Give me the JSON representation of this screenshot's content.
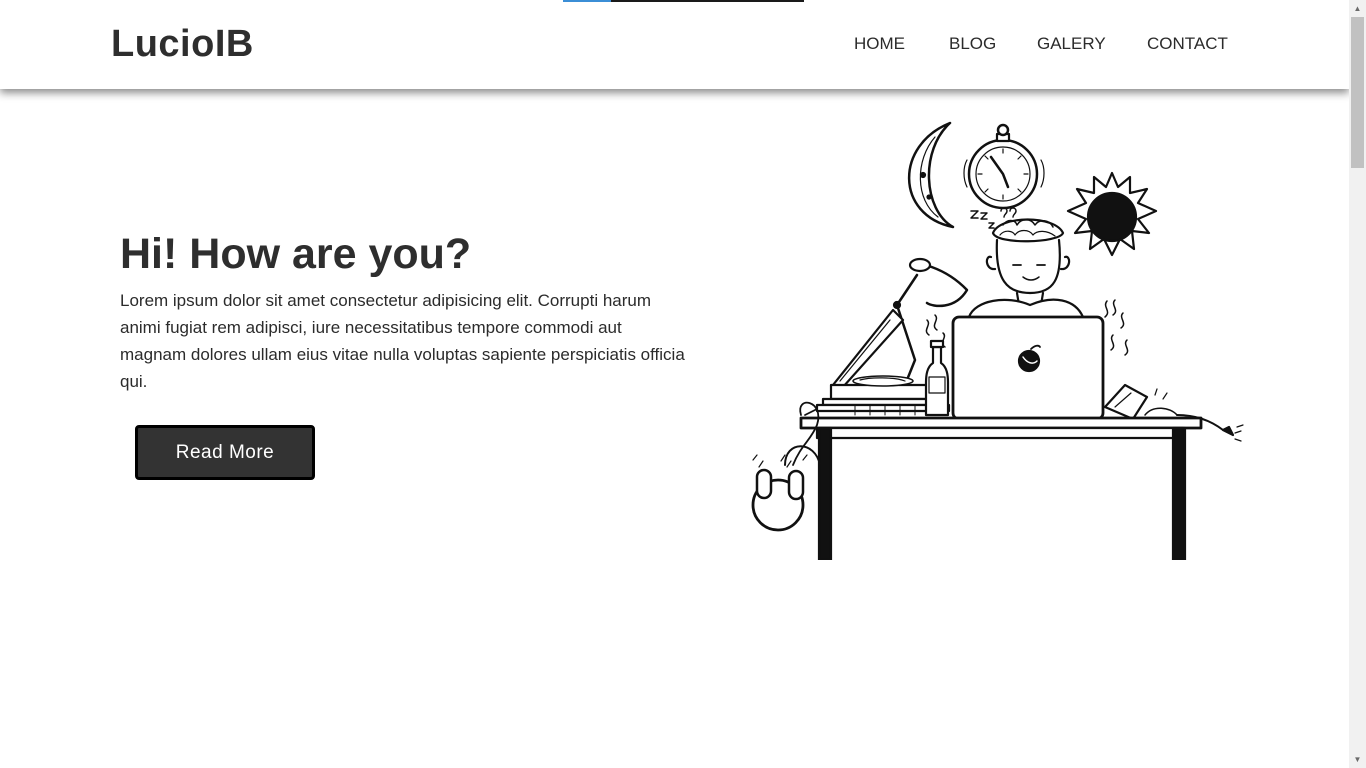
{
  "header": {
    "logo": "LucioIB",
    "nav": [
      {
        "label": "HOME"
      },
      {
        "label": "BLOG"
      },
      {
        "label": "GALERY"
      },
      {
        "label": "CONTACT"
      }
    ]
  },
  "hero": {
    "title": "Hi! How are you?",
    "text": "Lorem ipsum dolor sit amet consectetur adipisicing elit. Corrupti harum animi fugiat rem adipisci, iure necessitatibus tempore commodi aut magnam dolores ullam eius vitae nulla voluptas sapiente perspiciatis officia qui.",
    "button_label": "Read More"
  },
  "page_load_progress": 0.2,
  "icons": {
    "illustration": "person-working-at-laptop-illustration",
    "scroll_up": "triangle-up-icon",
    "scroll_down": "triangle-down-icon"
  },
  "colors": {
    "text": "#2e2e2e",
    "button_bg": "#333333",
    "button_border": "#000000",
    "progress": "#3b8ed6"
  }
}
